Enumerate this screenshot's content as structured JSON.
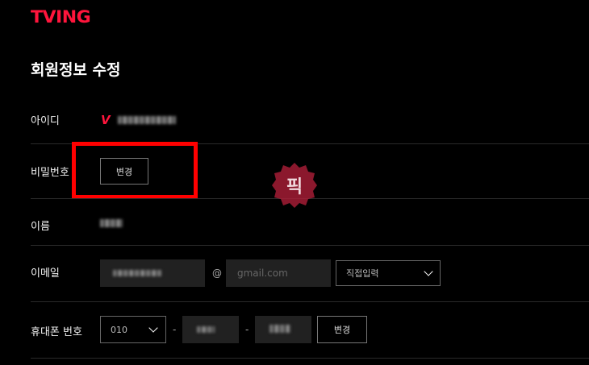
{
  "header": {
    "logo_text": "TVING"
  },
  "page": {
    "title": "회원정보 수정"
  },
  "fields": {
    "id": {
      "label": "아이디",
      "logo_mark": "V"
    },
    "password": {
      "label": "비밀번호",
      "change_button": "변경"
    },
    "name": {
      "label": "이름"
    },
    "email": {
      "label": "이메일",
      "at_sign": "@",
      "domain_value": "gmail.com",
      "domain_select": "직접입력"
    },
    "phone": {
      "label": "휴대폰 번호",
      "prefix_select": "010",
      "dash": "-",
      "change_button": "변경"
    }
  },
  "watermark": {
    "text": "픽"
  },
  "colors": {
    "brand": "#ff153c",
    "highlight_box": "#ff0000",
    "background": "#000000"
  }
}
